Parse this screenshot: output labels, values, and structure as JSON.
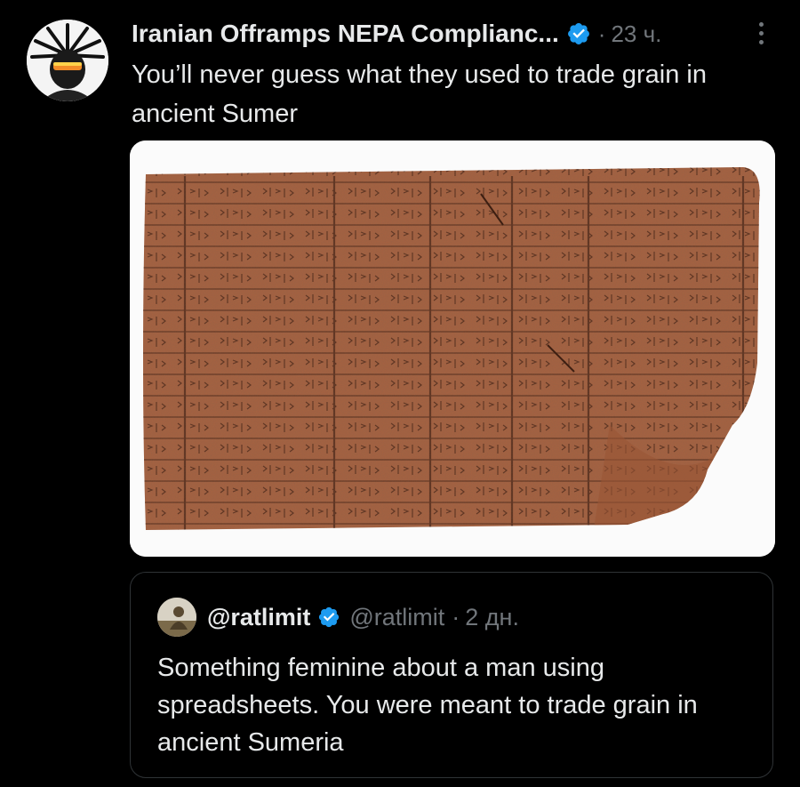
{
  "tweet": {
    "author_name": "Iranian Offramps NEPA Complianc...",
    "separator": "·",
    "time": "23 ч.",
    "text": "You’ll never guess what they used to trade grain in ancient Sumer",
    "media_icon": "clay-cuneiform-tablet-photo"
  },
  "quote": {
    "author_name": "@ratlimit",
    "handle": "@ratlimit",
    "separator": "·",
    "time": "2 дн.",
    "text": "Something feminine about a man using spreadsheets. You were meant to trade grain in ancient Sumeria"
  },
  "icons": {
    "verified": "verified-badge-icon",
    "more": "more-options-icon"
  },
  "colors": {
    "background": "#000000",
    "text_primary": "#e7e9ea",
    "text_secondary": "#71767b",
    "verified_blue": "#1d9bf0",
    "border": "#2f3336"
  }
}
